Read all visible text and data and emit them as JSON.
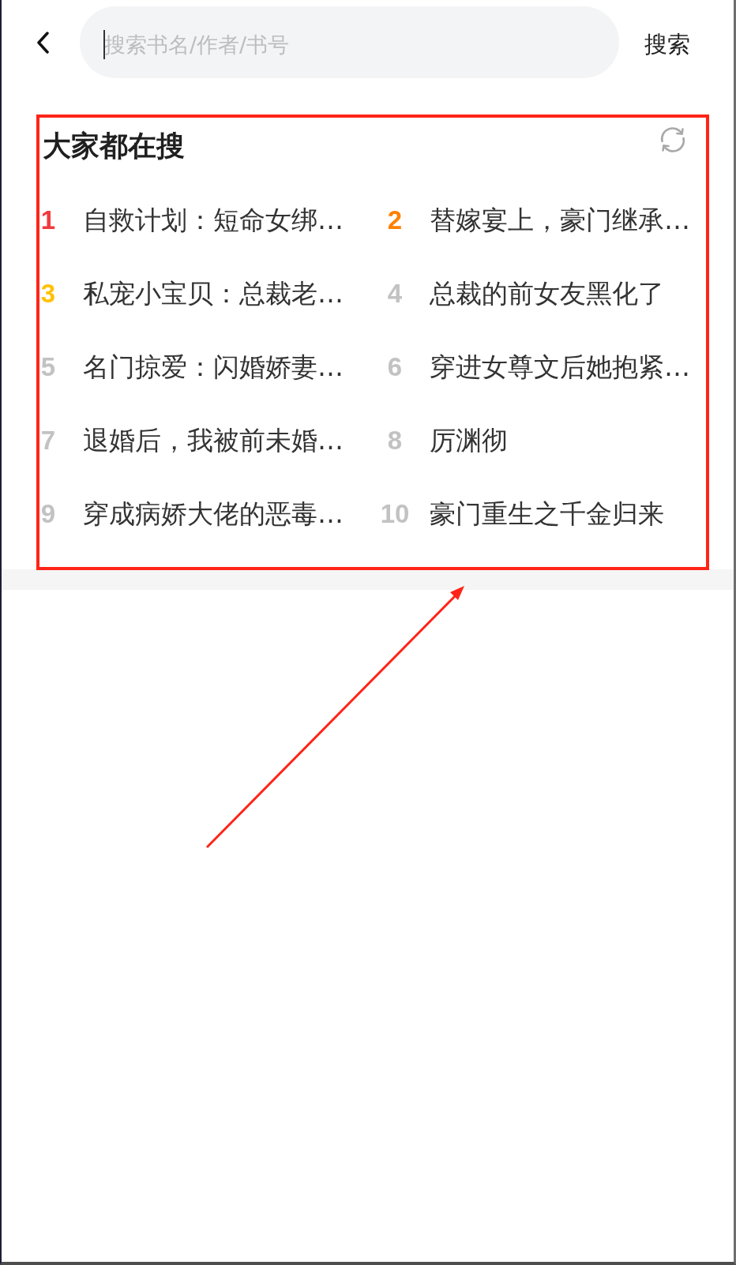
{
  "search": {
    "placeholder": "搜索书名/作者/书号",
    "focused": true
  },
  "search_button": "搜索",
  "hot_searches": {
    "title": "大家都在搜",
    "items": [
      {
        "rank": "1",
        "title": "自救计划：短命女绑…",
        "color": "#f23a3f"
      },
      {
        "rank": "2",
        "title": "替嫁宴上，豪门继承…",
        "color": "#ff8000"
      },
      {
        "rank": "3",
        "title": "私宠小宝贝：总裁老…",
        "color": "#ffc107"
      },
      {
        "rank": "4",
        "title": "总裁的前女友黑化了",
        "color": "#c2c2c2"
      },
      {
        "rank": "5",
        "title": "名门掠爱：闪婚娇妻…",
        "color": "#c2c2c2"
      },
      {
        "rank": "6",
        "title": "穿进女尊文后她抱紧…",
        "color": "#c2c2c2"
      },
      {
        "rank": "7",
        "title": "退婚后，我被前未婚…",
        "color": "#c2c2c2"
      },
      {
        "rank": "8",
        "title": "厉渊彻",
        "color": "#c2c2c2"
      },
      {
        "rank": "9",
        "title": "穿成病娇大佬的恶毒…",
        "color": "#c2c2c2"
      },
      {
        "rank": "10",
        "title": "豪门重生之千金归来",
        "color": "#c2c2c2"
      }
    ]
  },
  "annotations": [
    {
      "kind": "frame"
    },
    {
      "kind": "arrow"
    }
  ]
}
